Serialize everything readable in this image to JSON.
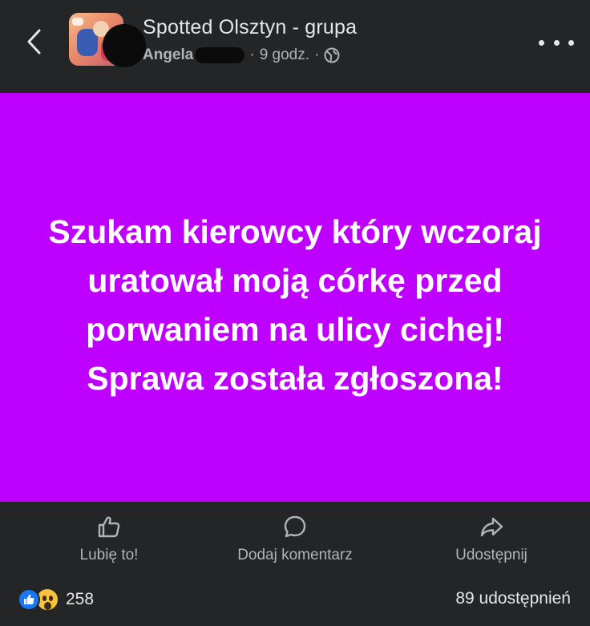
{
  "header": {
    "group_name": "Spotted Olsztyn - grupa",
    "author": "Angela",
    "time": "9 godz.",
    "separator": "·",
    "privacy_icon": "globe-icon",
    "back_icon": "chevron-left-icon",
    "more_icon": "more-horizontal-icon"
  },
  "post": {
    "background_color": "#bd00ff",
    "text": "Szukam kierowcy który wczoraj uratował moją córkę przed porwaniem na ulicy cichej! Sprawa została zgłoszona!"
  },
  "actions": {
    "like_label": "Lubię to!",
    "comment_label": "Dodaj komentarz",
    "share_label": "Udostępnij",
    "like_icon": "thumbs-up-icon",
    "comment_icon": "comment-bubble-icon",
    "share_icon": "share-arrow-icon"
  },
  "stats": {
    "reaction_count": "258",
    "reaction_icons": [
      "like-reaction-icon",
      "wow-reaction-icon"
    ],
    "shares": "89 udostępnień"
  },
  "colors": {
    "background": "#242526",
    "post_bg": "#bd00ff",
    "like_blue": "#1877f2",
    "wow_yellow": "#f7c23c",
    "text_primary": "#e4e6eb",
    "text_secondary": "#b0b3b8"
  }
}
